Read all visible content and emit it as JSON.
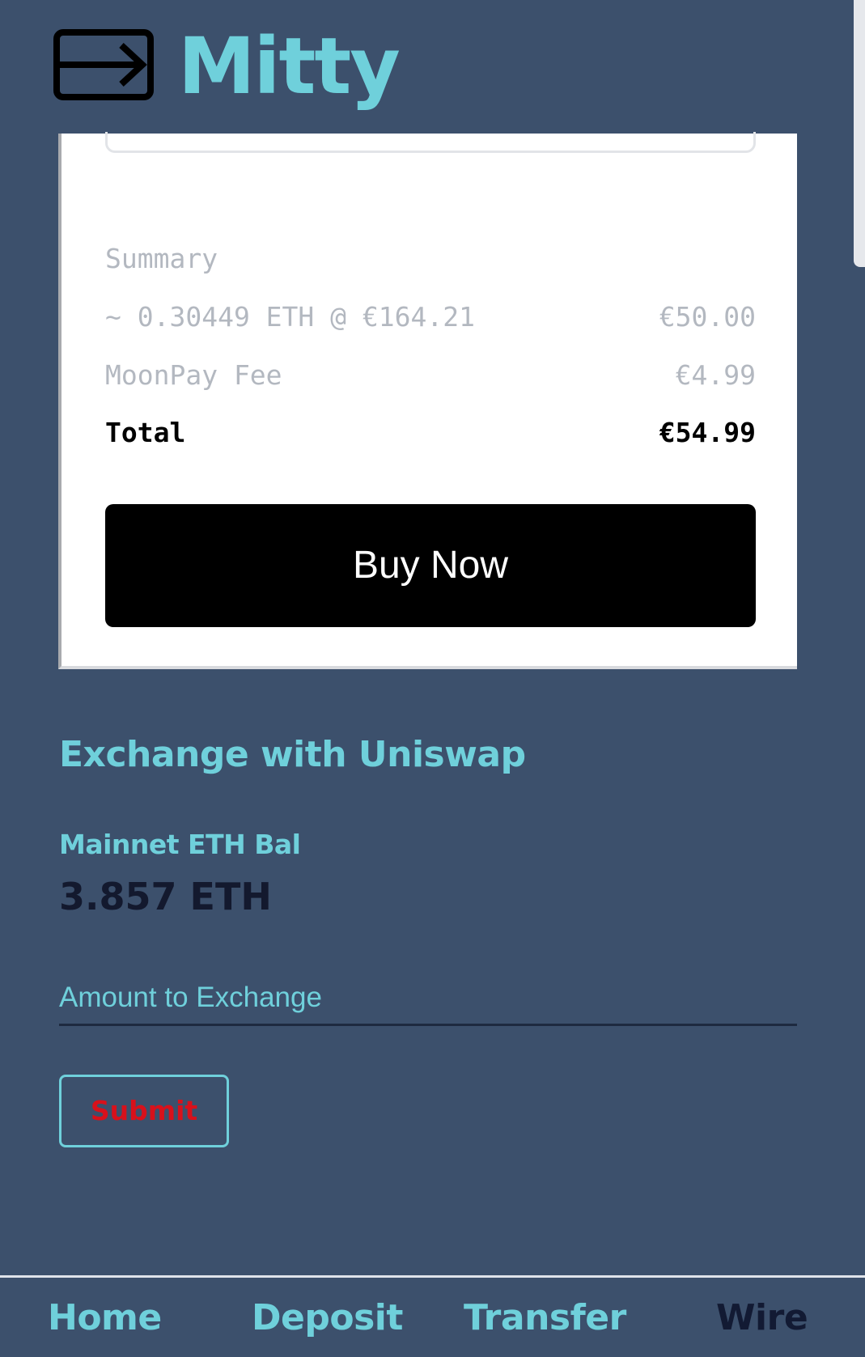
{
  "app": {
    "name": "Mitty",
    "logo_icon": "transfer-arrow-icon"
  },
  "colors": {
    "background": "#3c506c",
    "accent": "#6fd0db",
    "dark_text": "#13192e",
    "submit_text": "#d8111b",
    "card_bg": "#ffffff",
    "button_bg": "#000000"
  },
  "summary": {
    "title": "Summary",
    "eth_line_label": "~ 0.30449 ETH @ €164.21",
    "eth_line_value": "€50.00",
    "fee_label": "MoonPay Fee",
    "fee_value": "€4.99",
    "total_label": "Total",
    "total_value": "€54.99"
  },
  "buy_button": {
    "label": "Buy Now"
  },
  "exchange": {
    "title": "Exchange with Uniswap",
    "balance_label": "Mainnet ETH Bal",
    "balance_value": "3.857 ETH",
    "amount_placeholder": "Amount to Exchange",
    "amount_value": "",
    "submit_label": "Submit"
  },
  "nav": {
    "items": [
      {
        "label": "Home",
        "active": false
      },
      {
        "label": "Deposit",
        "active": false
      },
      {
        "label": "Transfer",
        "active": false
      },
      {
        "label": "Wire",
        "active": true
      }
    ]
  }
}
